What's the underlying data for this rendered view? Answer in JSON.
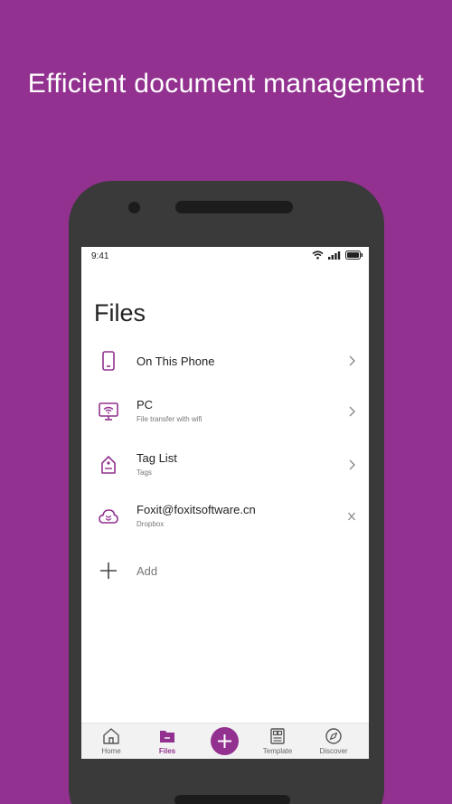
{
  "headline": "Efficient document management",
  "status_bar": {
    "time": "9:41"
  },
  "page": {
    "title": "Files"
  },
  "items": [
    {
      "label": "On This Phone",
      "sub": "",
      "icon": "phone-icon",
      "action": "chevron-right-icon"
    },
    {
      "label": "PC",
      "sub": "File transfer with wifi",
      "icon": "pc-wifi-icon",
      "action": "chevron-right-icon"
    },
    {
      "label": "Tag List",
      "sub": "Tags",
      "icon": "tag-icon",
      "action": "chevron-right-icon"
    },
    {
      "label": "Foxit@foxitsoftware.cn",
      "sub": "Dropbox",
      "icon": "dropbox-cloud-icon",
      "action": "close-icon"
    }
  ],
  "add": {
    "label": "Add"
  },
  "tabs": [
    {
      "label": "Home",
      "icon": "home-icon",
      "active": false
    },
    {
      "label": "Files",
      "icon": "folder-icon",
      "active": true
    },
    {
      "label": "Template",
      "icon": "template-icon",
      "active": false
    },
    {
      "label": "Discover",
      "icon": "compass-icon",
      "active": false
    }
  ],
  "colors": {
    "brand": "#92318f",
    "background": "#92318f",
    "phone_body": "#3a3a3a"
  }
}
